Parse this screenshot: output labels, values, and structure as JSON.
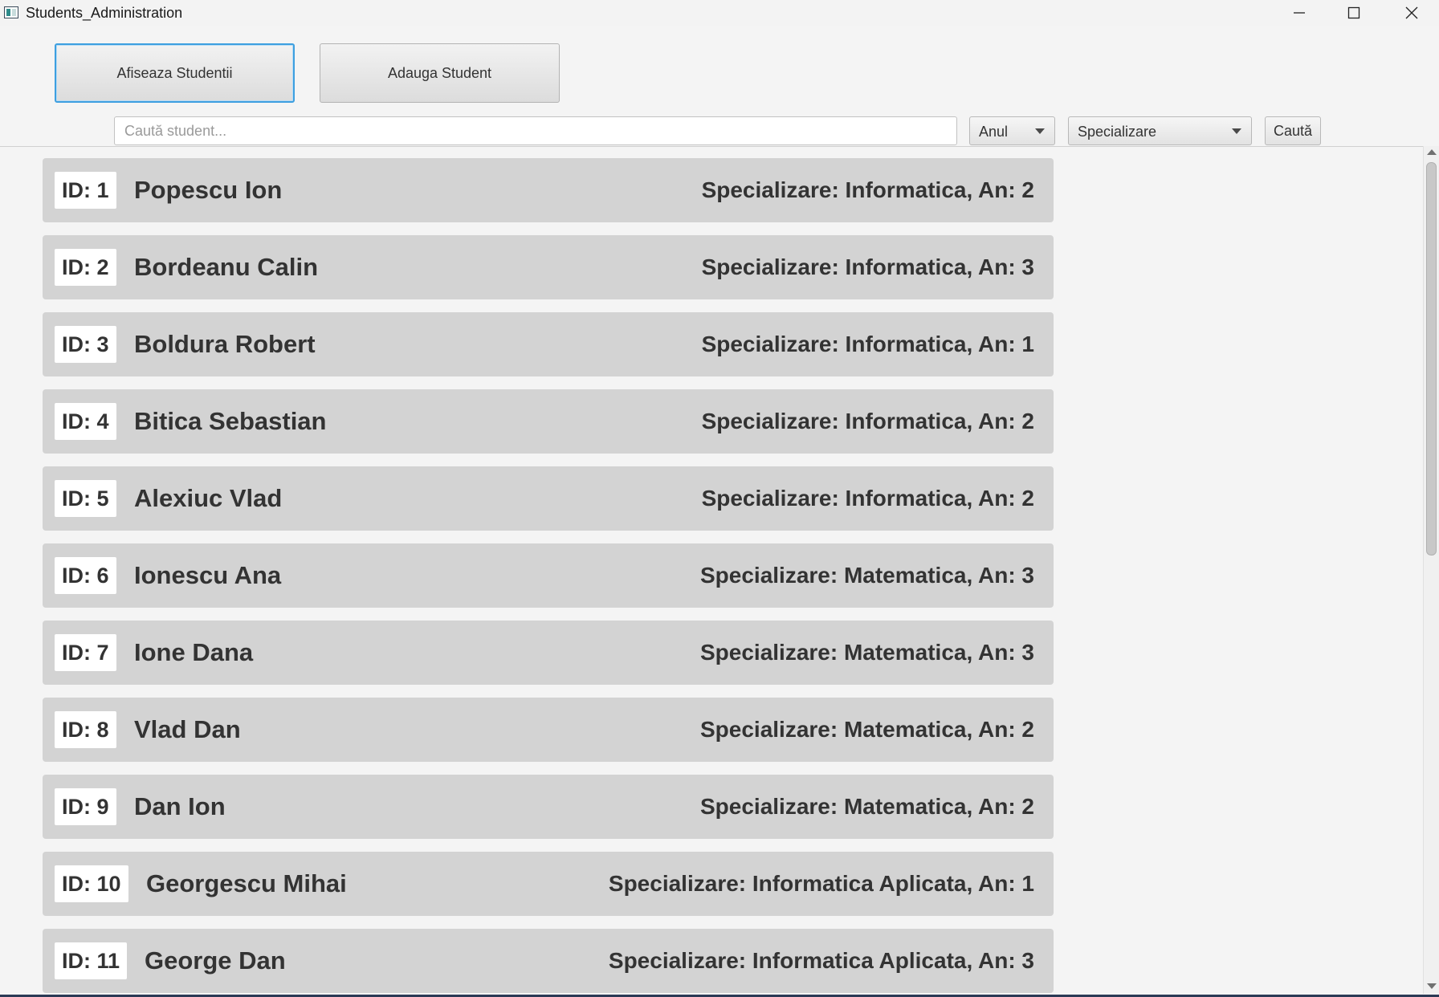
{
  "window": {
    "title": "Students_Administration",
    "accent_color": "#3d9fe0"
  },
  "toolbar": {
    "show_students_label": "Afiseaza Studentii",
    "add_student_label": "Adauga Student"
  },
  "search": {
    "placeholder": "Caută student...",
    "value": "",
    "year_combo_label": "Anul",
    "specialization_combo_label": "Specializare",
    "search_button_label": "Caută"
  },
  "students": [
    {
      "id": "ID: 1",
      "name": "Popescu Ion",
      "info": "Specializare: Informatica, An: 2"
    },
    {
      "id": "ID: 2",
      "name": "Bordeanu Calin",
      "info": "Specializare: Informatica, An: 3"
    },
    {
      "id": "ID: 3",
      "name": "Boldura Robert",
      "info": "Specializare: Informatica, An: 1"
    },
    {
      "id": "ID: 4",
      "name": "Bitica Sebastian",
      "info": "Specializare: Informatica, An: 2"
    },
    {
      "id": "ID: 5",
      "name": "Alexiuc Vlad",
      "info": "Specializare: Informatica, An: 2"
    },
    {
      "id": "ID: 6",
      "name": "Ionescu Ana",
      "info": "Specializare: Matematica, An: 3"
    },
    {
      "id": "ID: 7",
      "name": "Ione Dana",
      "info": "Specializare: Matematica, An: 3"
    },
    {
      "id": "ID: 8",
      "name": "Vlad Dan",
      "info": "Specializare: Matematica, An: 2"
    },
    {
      "id": "ID: 9",
      "name": "Dan Ion",
      "info": "Specializare: Matematica, An: 2"
    },
    {
      "id": "ID: 10",
      "name": "Georgescu Mihai",
      "info": "Specializare: Informatica Aplicata, An: 1"
    },
    {
      "id": "ID: 11",
      "name": "George Dan",
      "info": "Specializare: Informatica Aplicata, An: 3"
    }
  ]
}
